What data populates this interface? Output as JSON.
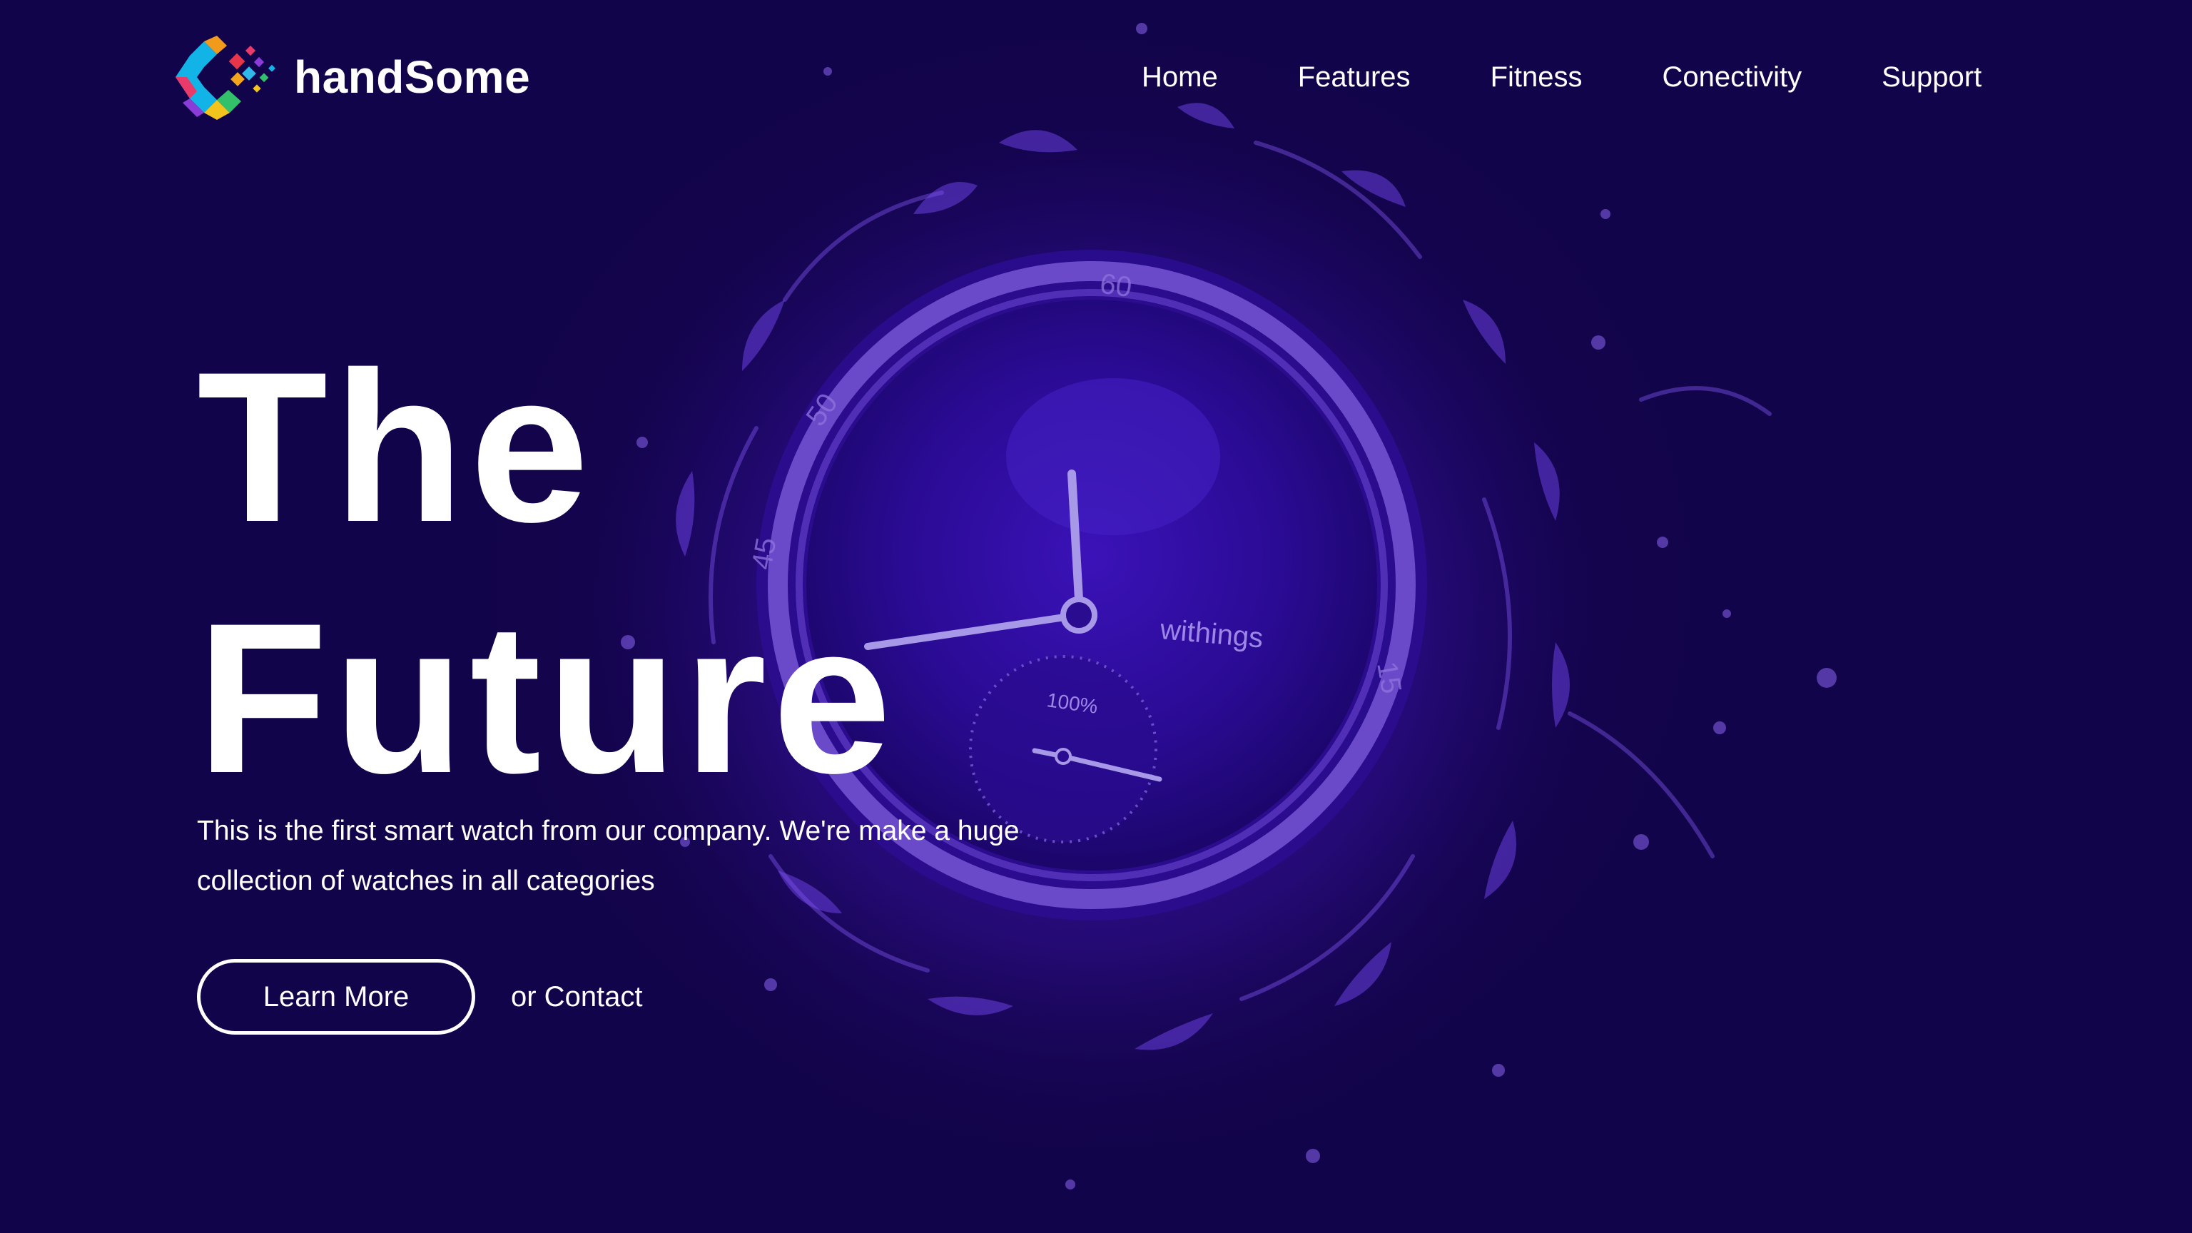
{
  "brand": {
    "name": "handSome",
    "logo_icon": "colorful-hexagon-logo-icon"
  },
  "nav": {
    "items": [
      {
        "label": "Home"
      },
      {
        "label": "Features"
      },
      {
        "label": "Fitness"
      },
      {
        "label": "Conectivity"
      },
      {
        "label": "Support"
      }
    ]
  },
  "hero": {
    "headline_line1": "The",
    "headline_line2": "Future",
    "description": "This is the first smart watch from our company. We're make a huge collection of watches in all categories",
    "primary_button": "Learn More",
    "secondary_link": "or Contact",
    "watch_brand_text": "withings",
    "dial_label": "100%",
    "bezel_numbers": [
      "60",
      "50",
      "45",
      "15"
    ]
  },
  "colors": {
    "background": "#14044e",
    "glow": "#2a0a8a",
    "watch_tint": "#3a16b0",
    "text": "#ffffff"
  }
}
